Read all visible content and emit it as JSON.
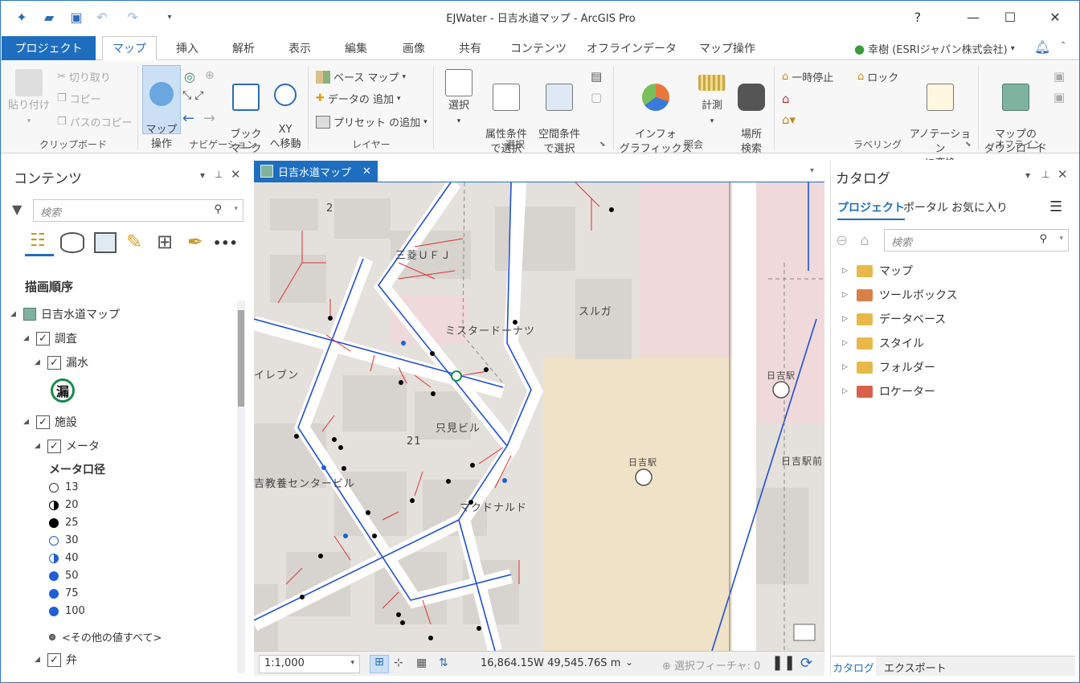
{
  "window": {
    "title": "EJWater - 日吉水道マップ - ArcGIS Pro",
    "help": "?",
    "min": "—",
    "max": "☐",
    "close": "✕"
  },
  "tabs": {
    "project": "プロジェクト",
    "items": [
      "マップ",
      "挿入",
      "解析",
      "表示",
      "編集",
      "画像",
      "共有",
      "コンテンツ",
      "オフラインデータ",
      "マップ操作"
    ],
    "active_index": 0
  },
  "user": {
    "name": "幸樹 (ESRIジャパン株式会社)",
    "caret": "▾"
  },
  "ribbon": {
    "clipboard": {
      "paste": "貼り付け",
      "cut": "切り取り",
      "copy": "コピー",
      "copy_path": "パスのコピー",
      "label": "クリップボード"
    },
    "navigation": {
      "explore": "マップ\n操作",
      "bookmarks": "ブック\nマーク",
      "goto_xy": "XY\nへ移動",
      "label": "ナビゲーション"
    },
    "layer": {
      "basemap": "ベース マップ",
      "add_data": "データの 追加",
      "add_preset": "プリセット の追加",
      "label": "レイヤー"
    },
    "selection": {
      "select": "選択",
      "by_attr": "属性条件\nで選択",
      "by_loc": "空間条件\nで選択",
      "label": "選択"
    },
    "inquiry": {
      "infographics": "インフォ\nグラフィックス",
      "measure": "計測",
      "locate": "場所\n検索",
      "label": "照会"
    },
    "labeling": {
      "pause": "一時停止",
      "lock": "ロック",
      "convert": "アノテーション\nに変換",
      "label": "ラベリング"
    },
    "offline": {
      "download": "マップの\nダウンロード",
      "label": "オフライン"
    }
  },
  "contents": {
    "title": "コンテンツ",
    "search_placeholder": "検索",
    "section": "描画順序",
    "map_name": "日吉水道マップ",
    "group_survey": "調査",
    "layer_leak": "漏水",
    "leak_symbol": "漏",
    "group_facility": "施設",
    "layer_meter": "メータ",
    "legend_title": "メータ口径",
    "legend": [
      {
        "label": "13",
        "color": "#ffffff",
        "style": "hollow"
      },
      {
        "label": "20",
        "color": "#000000",
        "style": "half"
      },
      {
        "label": "25",
        "color": "#000000",
        "style": "solid"
      },
      {
        "label": "30",
        "color": "#1f5fd6",
        "style": "hollow"
      },
      {
        "label": "40",
        "color": "#1f5fd6",
        "style": "half"
      },
      {
        "label": "50",
        "color": "#1f5fd6",
        "style": "solid"
      },
      {
        "label": "75",
        "color": "#1f5fd6",
        "style": "solid"
      },
      {
        "label": "100",
        "color": "#1f5fd6",
        "style": "solid"
      }
    ],
    "other_values": "<その他の値すべて>",
    "layer_valve": "弁"
  },
  "map": {
    "tab_title": "日吉水道マップ",
    "labels": {
      "num2": "2",
      "mufg": "三菱ＵＦＪ",
      "suruga": "スルガ",
      "misdo": "ミスタードーナツ",
      "eleven": "イレブン",
      "tadami": "只見ビル",
      "num21": "21",
      "kyoyo": "吉教養センタービル",
      "mcd": "マクドナルド",
      "station1": "日吉駅",
      "station2": "日吉駅",
      "station_front": "日吉駅前"
    },
    "scale": "1:1,000",
    "coords": "16,864.15W 49,545.76S m",
    "selected_features": "選択フィーチャ: 0"
  },
  "catalog": {
    "title": "カタログ",
    "tabs": [
      "プロジェクト",
      "ポータル",
      "お気に入り"
    ],
    "search_placeholder": "検索",
    "items": [
      "マップ",
      "ツールボックス",
      "データベース",
      "スタイル",
      "フォルダー",
      "ロケーター"
    ],
    "bottom_tabs": [
      "カタログ",
      "エクスポート"
    ]
  },
  "colors": {
    "accent": "#1e6ec0",
    "pipe": "#1f4fd6",
    "service": "#e03030"
  }
}
